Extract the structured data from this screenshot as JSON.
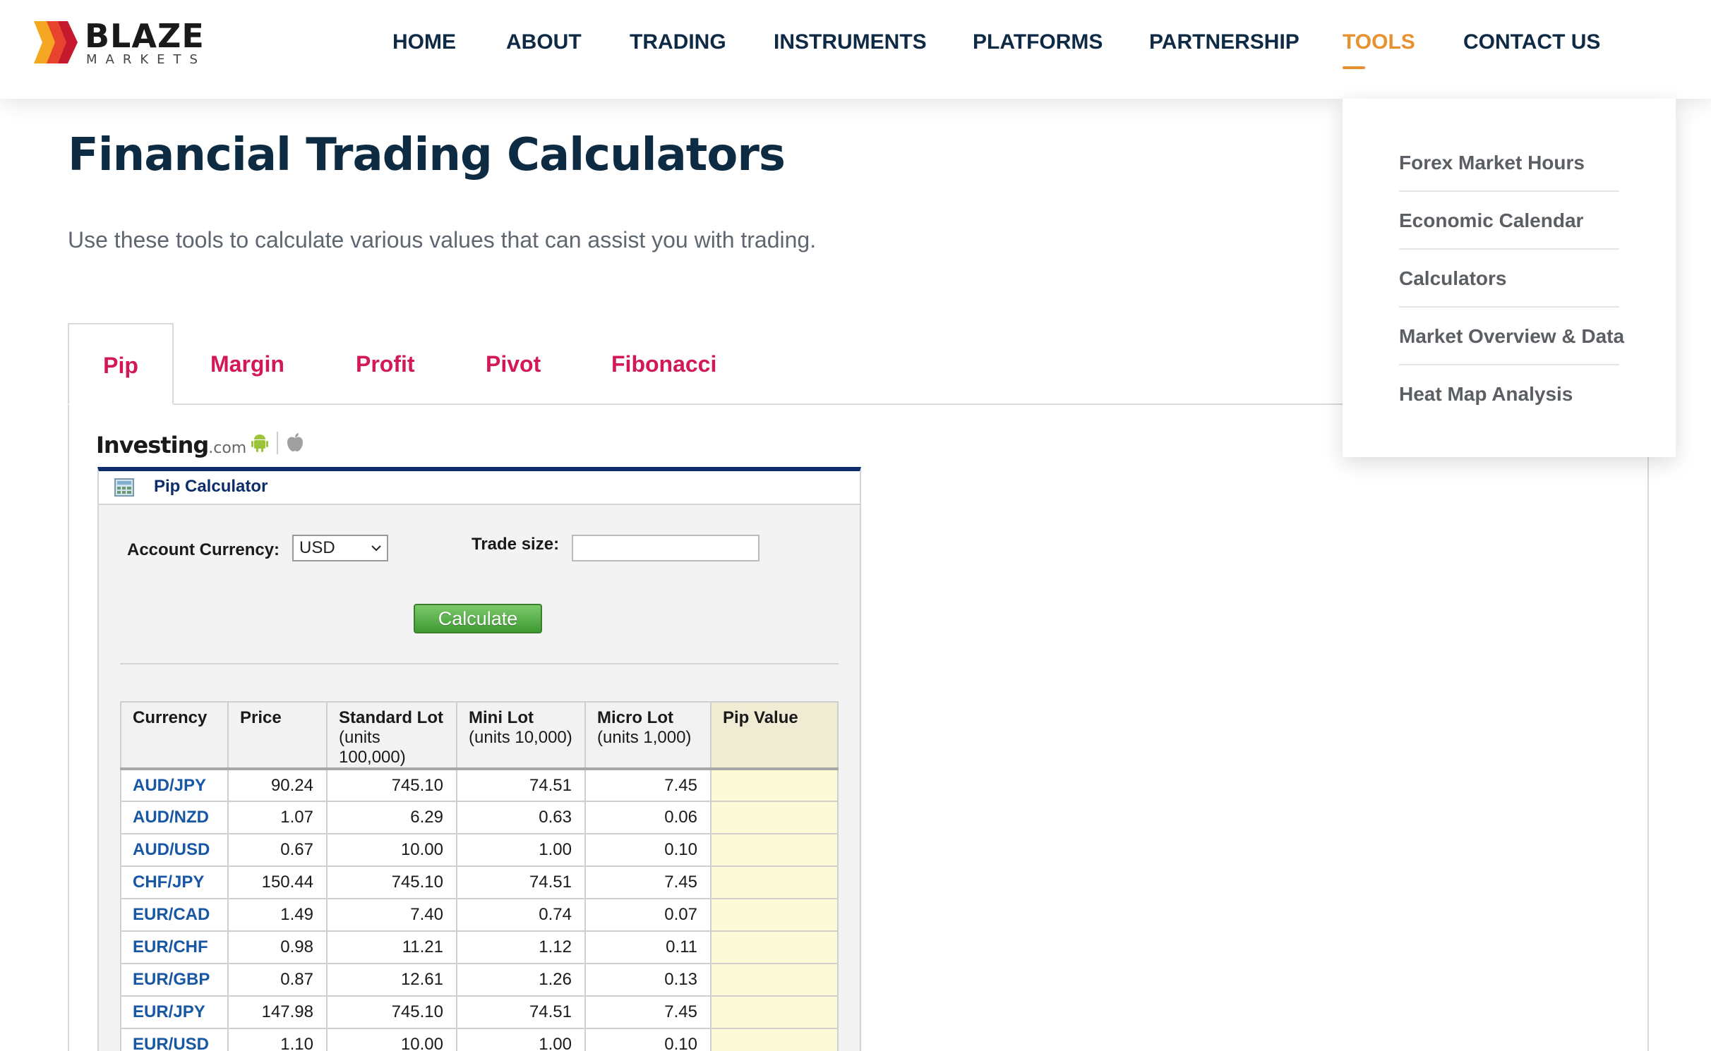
{
  "header": {
    "logo": {
      "word": "BLAZE",
      "sub": "MARKETS"
    },
    "nav": [
      {
        "label": "HOME"
      },
      {
        "label": "ABOUT"
      },
      {
        "label": "TRADING"
      },
      {
        "label": "INSTRUMENTS"
      },
      {
        "label": "PLATFORMS"
      },
      {
        "label": "PARTNERSHIP"
      },
      {
        "label": "TOOLS",
        "active": true
      },
      {
        "label": "CONTACT US"
      }
    ],
    "accent_color": "#e8912f",
    "text_color": "#0f2a44"
  },
  "tools_menu": {
    "items": [
      {
        "label": "Forex Market Hours"
      },
      {
        "label": "Economic Calendar"
      },
      {
        "label": "Calculators"
      },
      {
        "label": "Market Overview & Data"
      },
      {
        "label": "Heat Map Analysis"
      }
    ]
  },
  "page": {
    "title": "Financial Trading Calculators",
    "subtitle": "Use these tools to calculate various values that can assist you with trading."
  },
  "tabs": [
    {
      "label": "Pip",
      "active": true
    },
    {
      "label": "Margin"
    },
    {
      "label": "Profit"
    },
    {
      "label": "Pivot"
    },
    {
      "label": "Fibonacci"
    }
  ],
  "widget": {
    "brand": "Investing",
    "brand_suffix": ".com",
    "title": "Pip Calculator",
    "account_currency_label": "Account Currency:",
    "account_currency_value": "USD",
    "trade_size_label": "Trade size:",
    "trade_size_value": "",
    "calculate_label": "Calculate",
    "table": {
      "headers": [
        {
          "label": "Currency",
          "unit": ""
        },
        {
          "label": "Price",
          "unit": ""
        },
        {
          "label": "Standard Lot",
          "unit": "(units 100,000)"
        },
        {
          "label": "Mini Lot",
          "unit": "(units 10,000)"
        },
        {
          "label": "Micro Lot",
          "unit": "(units 1,000)"
        },
        {
          "label": "Pip Value",
          "unit": ""
        }
      ],
      "rows": [
        [
          "AUD/JPY",
          "90.24",
          "745.10",
          "74.51",
          "7.45",
          ""
        ],
        [
          "AUD/NZD",
          "1.07",
          "6.29",
          "0.63",
          "0.06",
          ""
        ],
        [
          "AUD/USD",
          "0.67",
          "10.00",
          "1.00",
          "0.10",
          ""
        ],
        [
          "CHF/JPY",
          "150.44",
          "745.10",
          "74.51",
          "7.45",
          ""
        ],
        [
          "EUR/CAD",
          "1.49",
          "7.40",
          "0.74",
          "0.07",
          ""
        ],
        [
          "EUR/CHF",
          "0.98",
          "11.21",
          "1.12",
          "0.11",
          ""
        ],
        [
          "EUR/GBP",
          "0.87",
          "12.61",
          "1.26",
          "0.13",
          ""
        ],
        [
          "EUR/JPY",
          "147.98",
          "745.10",
          "74.51",
          "7.45",
          ""
        ],
        [
          "EUR/USD",
          "1.10",
          "10.00",
          "1.00",
          "0.10",
          ""
        ]
      ]
    }
  }
}
